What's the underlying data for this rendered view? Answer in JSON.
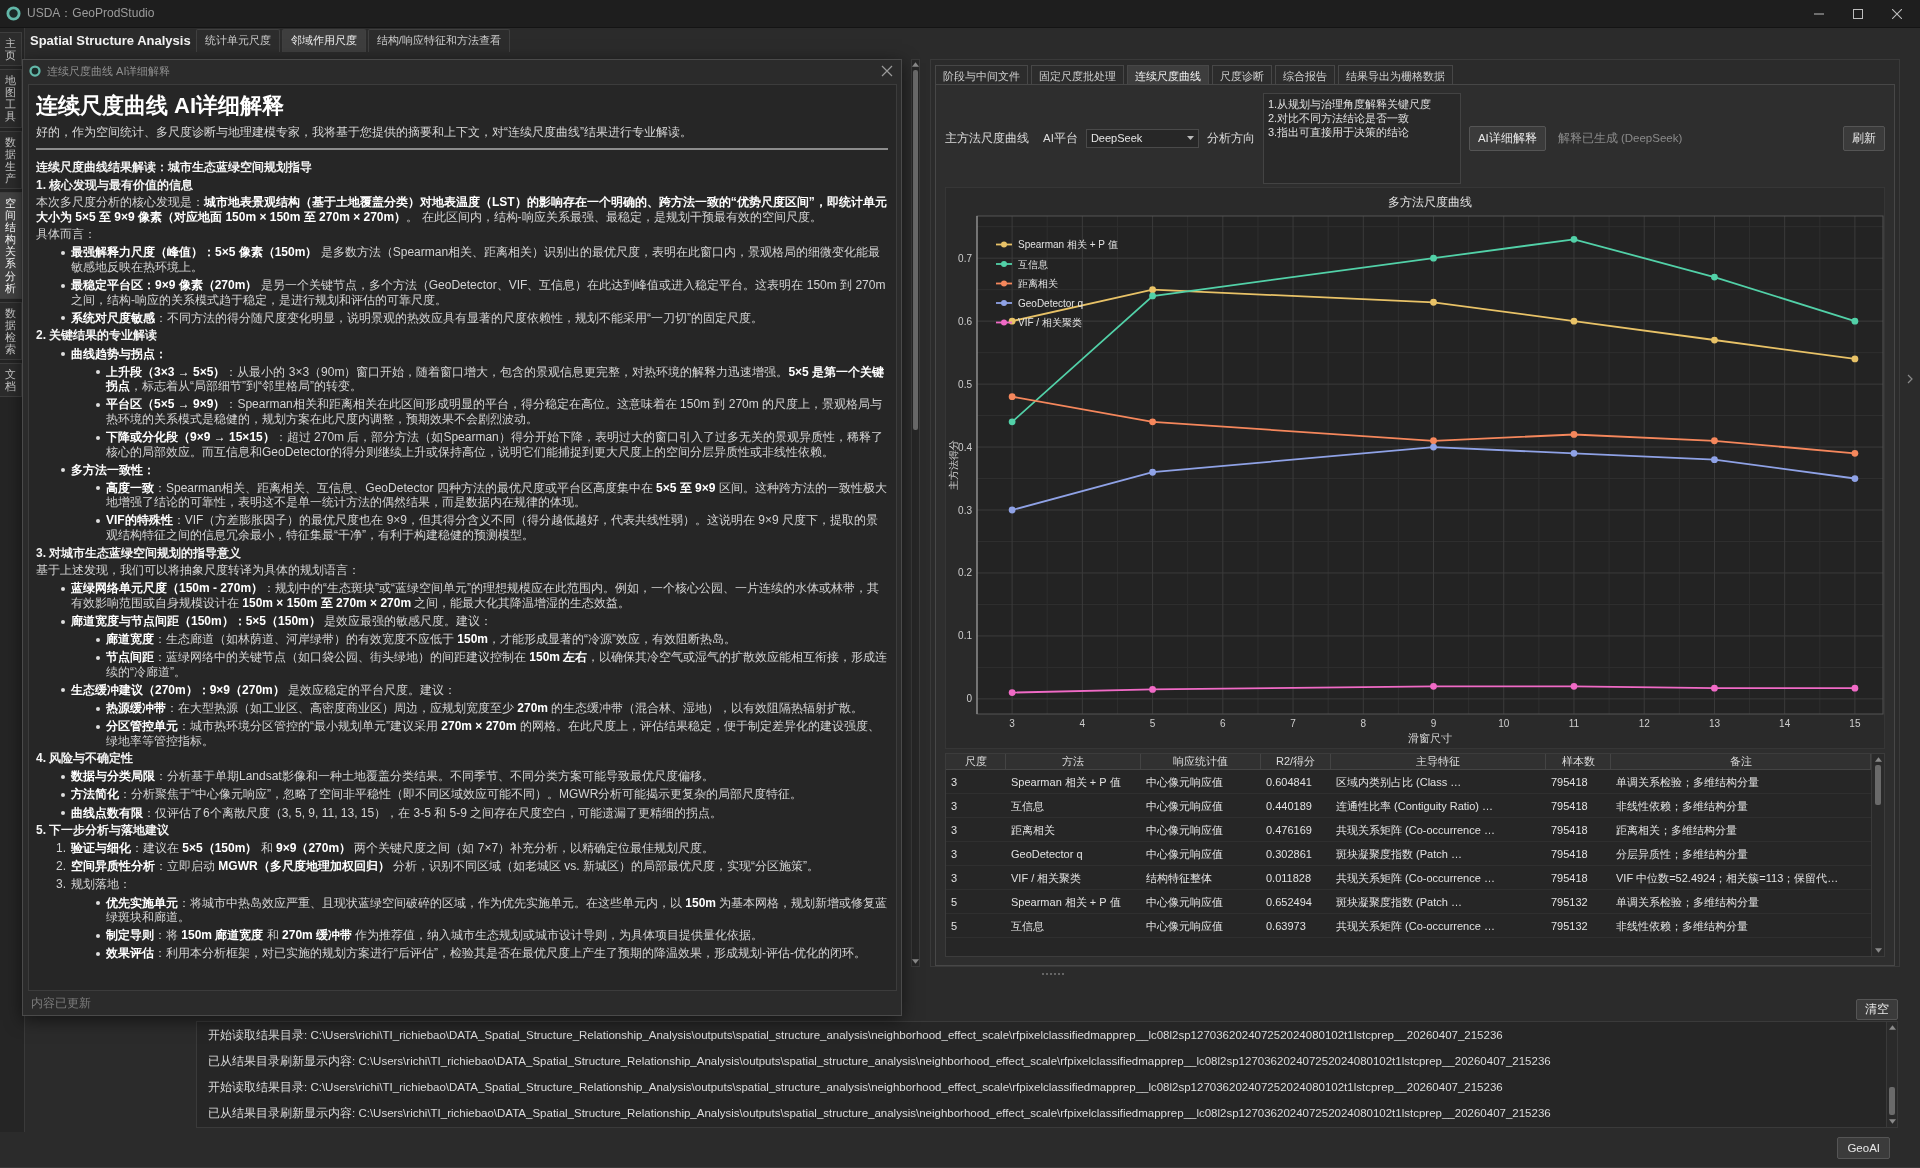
{
  "window": {
    "title": "USDA：GeoProdStudio"
  },
  "sidebar": {
    "tabs": [
      {
        "label": "主页",
        "selected": false
      },
      {
        "label": "地图工具",
        "selected": false
      },
      {
        "label": "数据生产",
        "selected": false
      },
      {
        "label": "空间结构关系分析",
        "selected": true
      },
      {
        "label": "数据检索",
        "selected": false
      },
      {
        "label": "文档",
        "selected": false
      }
    ]
  },
  "header": {
    "title": "Spatial Structure Analysis",
    "tabs": [
      {
        "label": "统计单元尺度",
        "selected": false
      },
      {
        "label": "邻域作用尺度",
        "selected": true
      },
      {
        "label": "结构/响应特征和方法查看",
        "selected": false
      }
    ]
  },
  "dialog": {
    "title": "连续尺度曲线 AI详细解释",
    "heading": "连续尺度曲线 AI详细解释",
    "intro": "好的，作为空间统计、多尺度诊断与地理建模专家，我将基于您提供的摘要和上下文，对“连续尺度曲线”结果进行专业解读。",
    "blocks": [
      {
        "kind": "heading",
        "text": "连续尺度曲线结果解读：城市生态蓝绿空间规划指导"
      },
      {
        "kind": "heading",
        "text": "1. 核心发现与最有价值的信息"
      },
      {
        "kind": "paragraph",
        "text": "本次多尺度分析的核心发现是：**城市地表景观结构（基于土地覆盖分类）对地表温度（LST）的影响存在一个明确的、跨方法一致的“优势尺度区间”，即统计单元大小为 5×5 至 9×9 像素（对应地面 150m × 150m 至 270m × 270m）**。 在此区间内，结构-响应关系最强、最稳定，是规划干预最有效的空间尺度。"
      },
      {
        "kind": "paragraph",
        "text": "具体而言："
      },
      {
        "kind": "bullets",
        "items": [
          {
            "text": "**最强解释力尺度（峰值）：5×5 像素（150m）** 是多数方法（Spearman相关、距离相关）识别出的最优尺度，表明在此窗口内，景观格局的细微变化能最敏感地反映在热环境上。"
          },
          {
            "text": "**最稳定平台区：9×9 像素（270m）** 是另一个关键节点，多个方法（GeoDetector、VIF、互信息）在此达到峰值或进入稳定平台。这表明在 150m 到 270m 之间，结构-响应的关系模式趋于稳定，是进行规划和评估的可靠尺度。"
          },
          {
            "text": "**系统对尺度敏感**：不同方法的得分随尺度变化明显，说明景观的热效应具有显著的尺度依赖性，规划不能采用“一刀切”的固定尺度。"
          }
        ]
      },
      {
        "kind": "heading",
        "text": "2. 关键结果的专业解读"
      },
      {
        "kind": "bullets",
        "items": [
          {
            "text": "**曲线趋势与拐点：**",
            "children": [
              {
                "text": "**上升段（3×3 → 5×5）**：从最小的 3×3（90m）窗口开始，随着窗口增大，包含的景观信息更完整，对热环境的解释力迅速增强。**5×5 是第一个关键拐点**，标志着从“局部细节”到“邻里格局”的转变。"
              },
              {
                "text": "**平台区（5×5 → 9×9）**：Spearman相关和距离相关在此区间形成明显的平台，得分稳定在高位。这意味着在 150m 到 270m 的尺度上，景观格局与热环境的关系模式是稳健的，规划方案在此尺度内调整，预期效果不会剧烈波动。"
              },
              {
                "text": "**下降或分化段（9×9 → 15×15）**：超过 270m 后，部分方法（如Spearman）得分开始下降，表明过大的窗口引入了过多无关的景观异质性，稀释了核心的局部效应。而互信息和GeoDetector的得分则继续上升或保持高位，说明它们能捕捉到更大尺度上的空间分层异质性或非线性依赖。"
              }
            ]
          },
          {
            "text": "**多方法一致性：**",
            "children": [
              {
                "text": "**高度一致**：Spearman相关、距离相关、互信息、GeoDetector 四种方法的最优尺度或平台区高度集中在 **5×5 至 9×9** 区间。这种跨方法的一致性极大地增强了结论的可靠性，表明这不是单一统计方法的偶然结果，而是数据内在规律的体现。"
              },
              {
                "text": "**VIF的特殊性**：VIF（方差膨胀因子）的最优尺度也在 9×9，但其得分含义不同（得分越低越好，代表共线性弱）。这说明在 9×9 尺度下，提取的景观结构特征之间的信息冗余最小，特征集最“干净”，有利于构建稳健的预测模型。"
              }
            ]
          }
        ]
      },
      {
        "kind": "heading",
        "text": "3. 对城市生态蓝绿空间规划的指导意义"
      },
      {
        "kind": "paragraph",
        "text": "基于上述发现，我们可以将抽象尺度转译为具体的规划语言："
      },
      {
        "kind": "bullets",
        "items": [
          {
            "text": "**蓝绿网络单元尺度（150m - 270m）**：规划中的“生态斑块”或“蓝绿空间单元”的理想规模应在此范围内。例如，一个核心公园、一片连续的水体或林带，其有效影响范围或自身规模设计在 **150m × 150m 至 270m × 270m** 之间，能最大化其降温增湿的生态效益。"
          },
          {
            "text": "**廊道宽度与节点间距（150m）：5×5（150m）** 是效应最强的敏感尺度。建议：",
            "children": [
              {
                "text": "**廊道宽度**：生态廊道（如林荫道、河岸绿带）的有效宽度不应低于 **150m**，才能形成显著的“冷源”效应，有效阻断热岛。"
              },
              {
                "text": "**节点间距**：蓝绿网络中的关键节点（如口袋公园、街头绿地）的间距建议控制在 **150m 左右**，以确保其冷空气或湿气的扩散效应能相互衔接，形成连续的“冷廊道”。"
              }
            ]
          },
          {
            "text": "**生态缓冲建议（270m）：9×9（270m）** 是效应稳定的平台尺度。建议：",
            "children": [
              {
                "text": "**热源缓冲带**：在大型热源（如工业区、高密度商业区）周边，应规划宽度至少 **270m** 的生态缓冲带（混合林、湿地），以有效阻隔热辐射扩散。"
              },
              {
                "text": "**分区管控单元**：城市热环境分区管控的“最小规划单元”建议采用 **270m × 270m** 的网格。在此尺度上，评估结果稳定，便于制定差异化的建设强度、绿地率等管控指标。"
              }
            ]
          }
        ]
      },
      {
        "kind": "heading",
        "text": "4. 风险与不确定性"
      },
      {
        "kind": "bullets",
        "items": [
          {
            "text": "**数据与分类局限**：分析基于单期Landsat影像和一种土地覆盖分类结果。不同季节、不同分类方案可能导致最优尺度偏移。"
          },
          {
            "text": "**方法简化**：分析聚焦于“中心像元响应”，忽略了空间非平稳性（即不同区域效应可能不同）。MGWR分析可能揭示更复杂的局部尺度特征。"
          },
          {
            "text": "**曲线点数有限**：仅评估了6个离散尺度（3, 5, 9, 11, 13, 15），在 3-5 和 5-9 之间存在尺度空白，可能遗漏了更精细的拐点。"
          }
        ]
      },
      {
        "kind": "heading",
        "text": "5. 下一步分析与落地建议"
      },
      {
        "kind": "numbered",
        "items": [
          {
            "number": "1.",
            "text": "**验证与细化**：建议在 **5×5（150m）** 和 **9×9（270m）** 两个关键尺度之间（如 7×7）补充分析，以精确定位最佳规划尺度。"
          },
          {
            "number": "2.",
            "text": "**空间异质性分析**：立即启动 **MGWR（多尺度地理加权回归）** 分析，识别不同区域（如老城区 vs. 新城区）的局部最优尺度，实现“分区施策”。"
          },
          {
            "number": "3.",
            "text": "规划落地：",
            "children": [
              {
                "text": "**优先实施单元**：将城市中热岛效应严重、且现状蓝绿空间破碎的区域，作为优先实施单元。在这些单元内，以 **150m** 为基本网格，规划新增或修复蓝绿斑块和廊道。"
              },
              {
                "text": "**制定导则**：将 **150m 廊道宽度** 和 **270m 缓冲带** 作为推荐值，纳入城市生态规划或城市设计导则，为具体项目提供量化依据。"
              },
              {
                "text": "**效果评估**：利用本分析框架，对已实施的规划方案进行“后评估”，检验其是否在最优尺度上产生了预期的降温效果，形成规划-评估-优化的闭环。"
              }
            ]
          }
        ]
      }
    ],
    "footer": "内容已更新"
  },
  "panel": {
    "tabs": [
      {
        "label": "阶段与中间文件",
        "selected": false
      },
      {
        "label": "固定尺度批处理",
        "selected": false
      },
      {
        "label": "连续尺度曲线",
        "selected": true
      },
      {
        "label": "尺度诊断",
        "selected": false
      },
      {
        "label": "综合报告",
        "selected": false
      },
      {
        "label": "结果导出为栅格数据",
        "selected": false
      }
    ],
    "controls": {
      "method_label": "主方法尺度曲线",
      "platform_label": "AI平台",
      "platform_value": "DeepSeek",
      "direction_label": "分析方向",
      "direction_text": "1.从规划与治理角度解释关键尺度\n2.对比不同方法结论是否一致\n3.指出可直接用于决策的结论",
      "explain_button": "AI详细解释",
      "status": "解释已生成 (DeepSeek)",
      "refresh_button": "刷新"
    },
    "chart_data": {
      "type": "line",
      "title": "多方法尺度曲线",
      "xlabel": "滑窗尺寸",
      "ylabel": "主方法得分",
      "x": [
        3,
        5,
        9,
        11,
        13,
        15
      ],
      "series": [
        {
          "name": "Spearman 相关 + P 值",
          "color": "#e8c267",
          "marker": "o",
          "values": [
            0.6,
            0.65,
            0.63,
            0.6,
            0.57,
            0.54
          ]
        },
        {
          "name": "互信息",
          "color": "#52d1a8",
          "marker": "o",
          "values": [
            0.44,
            0.64,
            0.7,
            0.73,
            0.67,
            0.6
          ]
        },
        {
          "name": "距离相关",
          "color": "#f5875c",
          "marker": "o",
          "values": [
            0.48,
            0.44,
            0.41,
            0.42,
            0.41,
            0.39
          ]
        },
        {
          "name": "GeoDetector q",
          "color": "#8fa2e6",
          "marker": "o",
          "values": [
            0.3,
            0.36,
            0.4,
            0.39,
            0.38,
            0.35
          ]
        },
        {
          "name": "VIF / 相关聚类",
          "color": "#f06ac6",
          "marker": "o",
          "values": [
            0.01,
            0.015,
            0.02,
            0.02,
            0.017,
            0.017
          ]
        }
      ],
      "xlim": [
        2.5,
        15.4
      ],
      "ylim": [
        -0.024,
        0.767
      ],
      "xticks": [
        {
          "value": 3,
          "label": "3"
        },
        {
          "value": 4,
          "label": "4"
        },
        {
          "value": 5,
          "label": "5"
        },
        {
          "value": 6,
          "label": "6"
        },
        {
          "value": 7,
          "label": "7"
        },
        {
          "value": 8,
          "label": "8"
        },
        {
          "value": 9,
          "label": "9"
        },
        {
          "value": 10,
          "label": "10"
        },
        {
          "value": 11,
          "label": "11"
        },
        {
          "value": 12,
          "label": "12"
        },
        {
          "value": 13,
          "label": "13"
        },
        {
          "value": 14,
          "label": "14"
        },
        {
          "value": 15,
          "label": "15"
        }
      ],
      "yticks": [
        0,
        0.1,
        0.2,
        0.3,
        0.4,
        0.5,
        0.6,
        0.7
      ],
      "grid": true,
      "legend": "upper left"
    },
    "table": {
      "columns": [
        "尺度",
        "方法",
        "响应统计值",
        "R2/得分",
        "主导特征",
        "样本数",
        "备注"
      ],
      "rows": [
        [
          "3",
          "Spearman 相关 + P 值",
          "中心像元响应值",
          "0.604841",
          "区域内类别占比 (Class …",
          "795418",
          "单调关系检验；多维结构分量"
        ],
        [
          "3",
          "互信息",
          "中心像元响应值",
          "0.440189",
          "连通性比率 (Contiguity Ratio) …",
          "795418",
          "非线性依赖；多维结构分量"
        ],
        [
          "3",
          "距离相关",
          "中心像元响应值",
          "0.476169",
          "共现关系矩阵 (Co-occurrence …",
          "795418",
          "距离相关；多维结构分量"
        ],
        [
          "3",
          "GeoDetector q",
          "中心像元响应值",
          "0.302861",
          "斑块凝聚度指数 (Patch …",
          "795418",
          "分层异质性；多维结构分量"
        ],
        [
          "3",
          "VIF / 相关聚类",
          "结构特征整体",
          "0.011828",
          "共现关系矩阵 (Co-occurrence …",
          "795418",
          "VIF 中位数=52.4924；相关簇=113；保留代…"
        ],
        [
          "5",
          "Spearman 相关 + P 值",
          "中心像元响应值",
          "0.652494",
          "斑块凝聚度指数 (Patch …",
          "795132",
          "单调关系检验；多维结构分量"
        ],
        [
          "5",
          "互信息",
          "中心像元响应值",
          "0.63973",
          "共现关系矩阵 (Co-occurrence …",
          "795132",
          "非线性依赖；多维结构分量"
        ]
      ]
    }
  },
  "log": {
    "clear_button": "清空",
    "lines": [
      "开始读取结果目录: C:\\Users\\richi\\TI_richiebao\\DATA_Spatial_Structure_Relationship_Analysis\\outputs\\spatial_structure_analysis\\neighborhood_effect_scale\\rfpixelclassifiedmapprep__lc08l2sp127036202407252024080102t1lstcprep__20260407_215236",
      "已从结果目录刷新显示内容: C:\\Users\\richi\\TI_richiebao\\DATA_Spatial_Structure_Relationship_Analysis\\outputs\\spatial_structure_analysis\\neighborhood_effect_scale\\rfpixelclassifiedmapprep__lc08l2sp127036202407252024080102t1lstcprep__20260407_215236",
      "开始读取结果目录: C:\\Users\\richi\\TI_richiebao\\DATA_Spatial_Structure_Relationship_Analysis\\outputs\\spatial_structure_analysis\\neighborhood_effect_scale\\rfpixelclassifiedmapprep__lc08l2sp127036202407252024080102t1lstcprep__20260407_215236",
      "已从结果目录刷新显示内容: C:\\Users\\richi\\TI_richiebao\\DATA_Spatial_Structure_Relationship_Analysis\\outputs\\spatial_structure_analysis\\neighborhood_effect_scale\\rfpixelclassifiedmapprep__lc08l2sp127036202407252024080102t1lstcprep__20260407_215236"
    ]
  },
  "status_bar": {
    "button": "GeoAI"
  }
}
